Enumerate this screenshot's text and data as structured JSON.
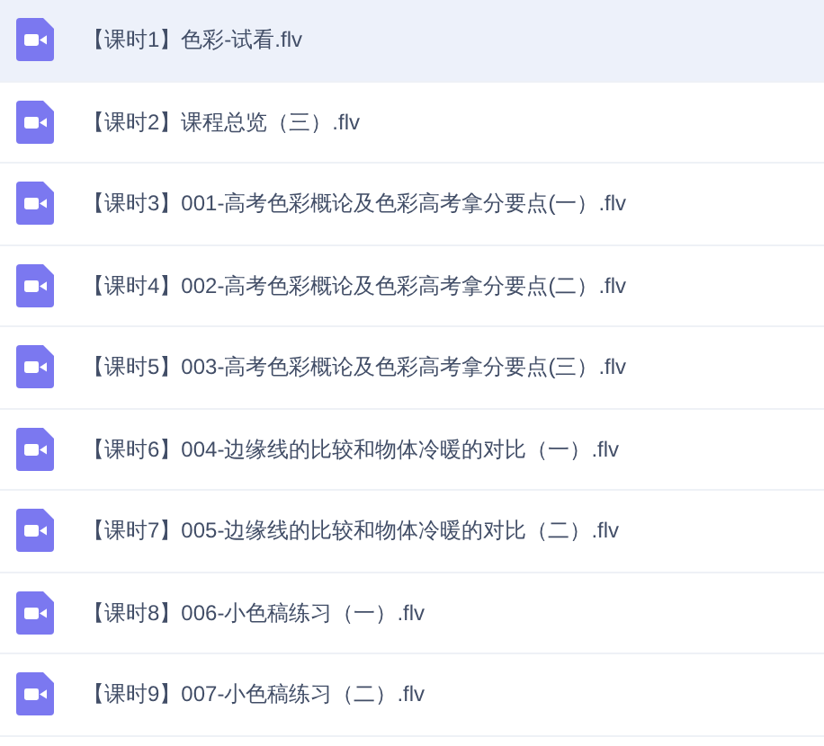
{
  "files": [
    {
      "name": "【课时1】色彩-试看.flv",
      "selected": true
    },
    {
      "name": "【课时2】课程总览（三）.flv",
      "selected": false
    },
    {
      "name": "【课时3】001-高考色彩概论及色彩高考拿分要点(一）.flv",
      "selected": false
    },
    {
      "name": "【课时4】002-高考色彩概论及色彩高考拿分要点(二）.flv",
      "selected": false
    },
    {
      "name": "【课时5】003-高考色彩概论及色彩高考拿分要点(三）.flv",
      "selected": false
    },
    {
      "name": "【课时6】004-边缘线的比较和物体冷暖的对比（一）.flv",
      "selected": false
    },
    {
      "name": "【课时7】005-边缘线的比较和物体冷暖的对比（二）.flv",
      "selected": false
    },
    {
      "name": "【课时8】006-小色稿练习（一）.flv",
      "selected": false
    },
    {
      "name": "【课时9】007-小色稿练习（二）.flv",
      "selected": false
    }
  ]
}
